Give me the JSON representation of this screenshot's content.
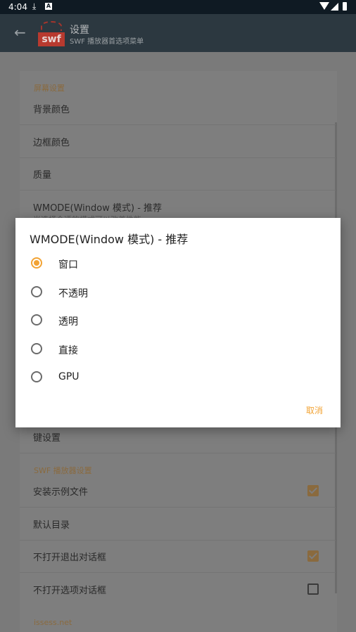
{
  "status_bar": {
    "time": "4:04"
  },
  "toolbar": {
    "title": "设置",
    "subtitle": "SWF 播放器首选项菜单",
    "logo_text": "swf"
  },
  "settings": {
    "section_screen": "屏幕设置",
    "items_top": [
      {
        "label": "背景颜色"
      },
      {
        "label": "边框颜色"
      },
      {
        "label": "质量"
      },
      {
        "label": "WMODE(Window 模式) - 推荐",
        "sub": "当选择合适的模式可以改善性能"
      }
    ],
    "key_settings": "键设置",
    "section_player": "SWF 播放器设置",
    "items_player": [
      {
        "label": "安装示例文件",
        "checked": true
      },
      {
        "label": "默认目录"
      },
      {
        "label": "不打开退出对话框",
        "checked": true
      },
      {
        "label": "不打开选项对话框",
        "checked": false
      }
    ],
    "footer_link": "issess.net"
  },
  "dialog": {
    "title": "WMODE(Window 模式) - 推荐",
    "options": [
      {
        "label": "窗口",
        "selected": true
      },
      {
        "label": "不透明",
        "selected": false
      },
      {
        "label": "透明",
        "selected": false
      },
      {
        "label": "直接",
        "selected": false
      },
      {
        "label": "GPU",
        "selected": false
      }
    ],
    "cancel_label": "取消"
  },
  "colors": {
    "accent": "#f2a334",
    "toolbar": "#2c3840",
    "statusbar": "#0f1a23"
  }
}
